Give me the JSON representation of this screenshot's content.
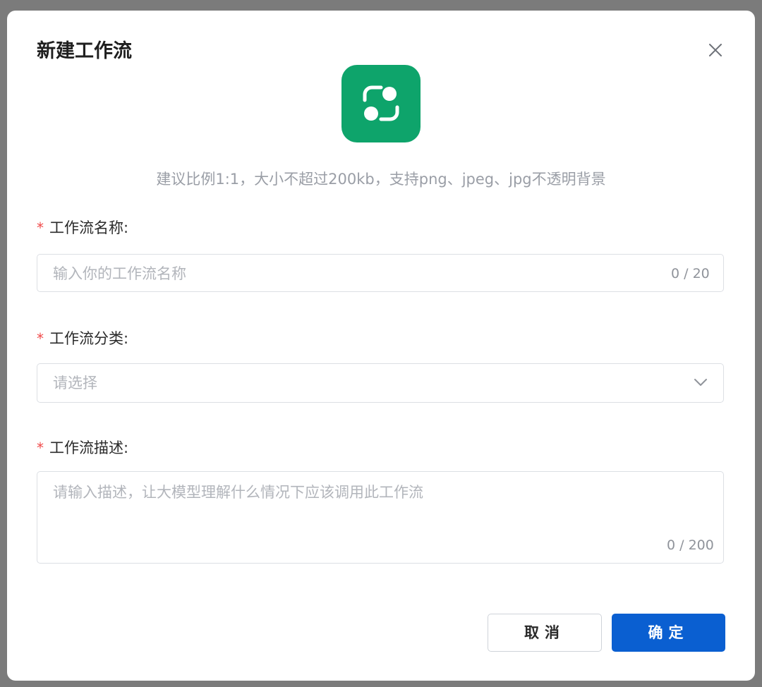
{
  "dialog": {
    "title": "新建工作流",
    "close_icon": "close-icon",
    "logo_icon": "workflow-icon",
    "logo_color": "#0ea46b",
    "upload_hint": "建议比例1:1，大小不超过200kb，支持png、jpeg、jpg不透明背景"
  },
  "fields": {
    "name": {
      "required_mark": "*",
      "label": "工作流名称:",
      "placeholder": "输入你的工作流名称",
      "counter": "0 / 20"
    },
    "category": {
      "required_mark": "*",
      "label": "工作流分类:",
      "placeholder": "请选择"
    },
    "description": {
      "required_mark": "*",
      "label": "工作流描述:",
      "placeholder": "请输入描述，让大模型理解什么情况下应该调用此工作流",
      "counter": "0 / 200"
    }
  },
  "buttons": {
    "cancel": "取消",
    "confirm": "确定",
    "confirm_color": "#0a5fd1"
  }
}
